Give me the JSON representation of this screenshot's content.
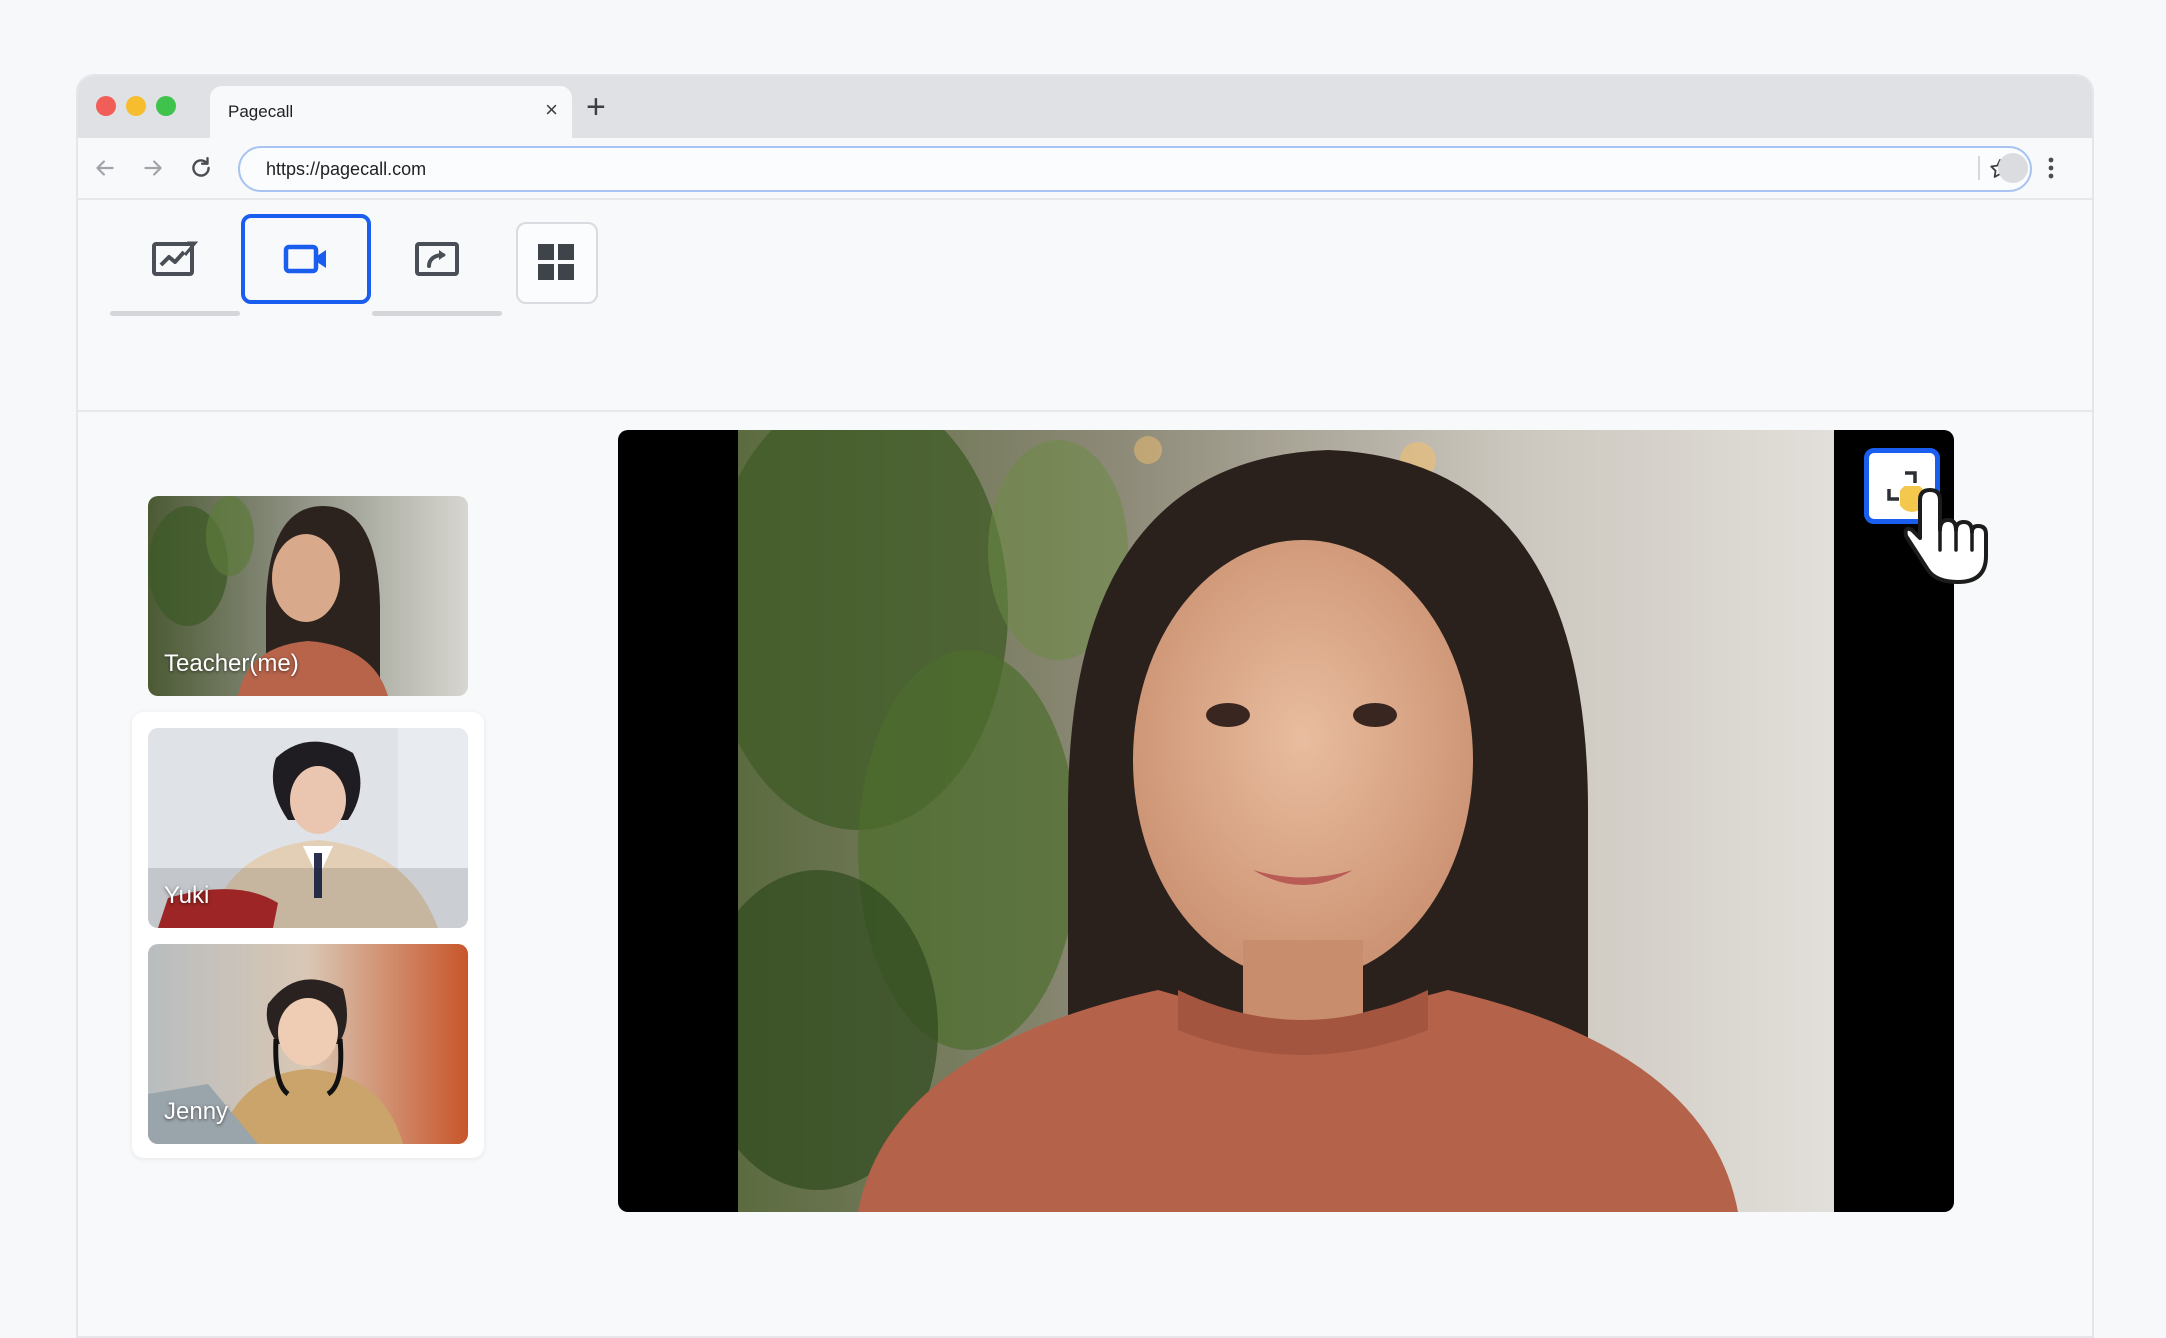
{
  "browser": {
    "tab_title": "Pagecall",
    "tab_close": "×",
    "new_tab": "+",
    "url": "https://pagecall.com"
  },
  "app_toolbar": {
    "modes": [
      {
        "name": "whiteboard",
        "icon": "whiteboard-chart-icon",
        "active": false
      },
      {
        "name": "video",
        "icon": "video-camera-icon",
        "active": true
      },
      {
        "name": "screen-share",
        "icon": "screen-share-icon",
        "active": false
      }
    ],
    "layout_icon": "grid-layout-icon"
  },
  "participants": [
    {
      "label": "Teacher(me)"
    },
    {
      "label": "Yuki"
    },
    {
      "label": "Jenny"
    }
  ],
  "main_video": {
    "expand_icon": "expand-icon",
    "cursor_icon": "hand-pointer-icon"
  },
  "colors": {
    "accent": "#1a5ef0",
    "close_light": "#f05e57",
    "minimize_light": "#f6be2f",
    "zoom_light": "#3fc34c"
  }
}
